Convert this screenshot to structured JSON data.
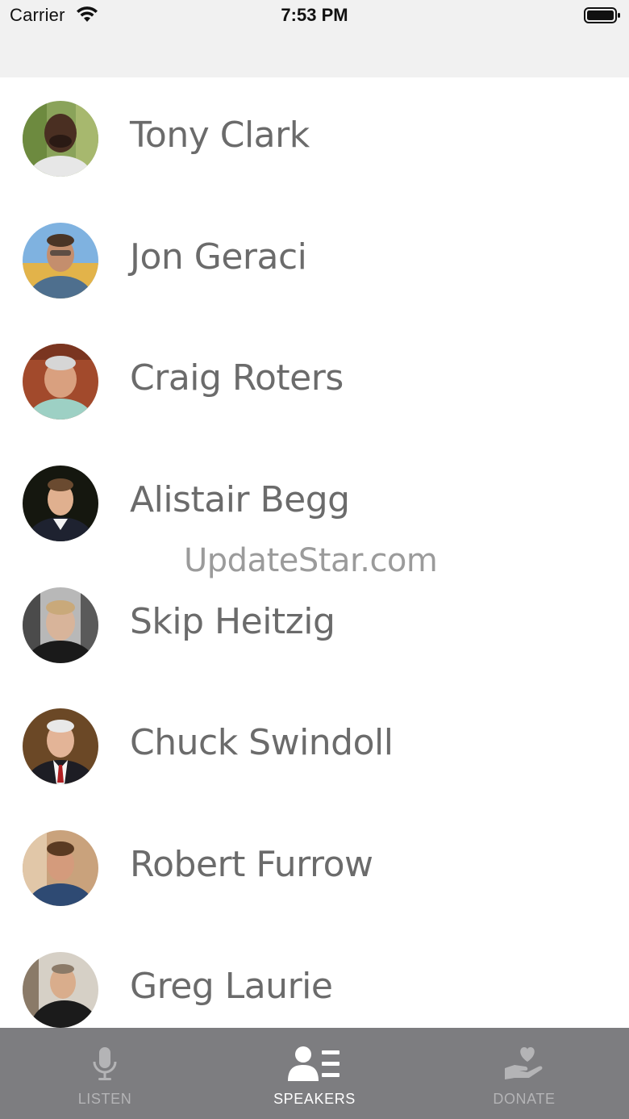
{
  "status_bar": {
    "carrier": "Carrier",
    "time": "7:53 PM"
  },
  "speakers": [
    {
      "name": "Tony Clark"
    },
    {
      "name": "Jon Geraci"
    },
    {
      "name": "Craig Roters"
    },
    {
      "name": "Alistair Begg"
    },
    {
      "name": "Skip Heitzig"
    },
    {
      "name": "Chuck Swindoll"
    },
    {
      "name": "Robert Furrow"
    },
    {
      "name": "Greg Laurie"
    }
  ],
  "watermark": "UpdateStar.com",
  "tabs": [
    {
      "label": "LISTEN",
      "icon": "microphone-icon",
      "active": false
    },
    {
      "label": "SPEAKERS",
      "icon": "speakers-list-icon",
      "active": true
    },
    {
      "label": "DONATE",
      "icon": "donate-heart-hand-icon",
      "active": false
    }
  ],
  "colors": {
    "tab_bar_bg": "#7d7d80",
    "tab_active": "#ffffff",
    "tab_inactive": "#b4b4b6",
    "name_text": "#6b6b6b",
    "status_bg": "#f1f1f1"
  }
}
